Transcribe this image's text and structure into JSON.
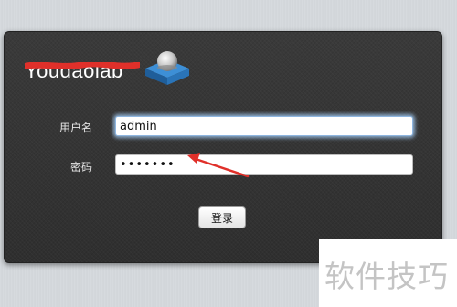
{
  "logo": {
    "text": "Youdaolab",
    "icon": "database-server-icon"
  },
  "form": {
    "username_label": "用户名",
    "username_value": "admin",
    "password_label": "密码",
    "password_value": "•••••••",
    "submit_label": "登录"
  },
  "annotation": {
    "icon": "red-arrow-pointer",
    "color": "#e0302a"
  },
  "watermark": {
    "text": "软件技巧"
  },
  "colors": {
    "panel": "#3b3b3b",
    "background": "#d4d8dc",
    "focus_glow": "#a0c8f0"
  }
}
